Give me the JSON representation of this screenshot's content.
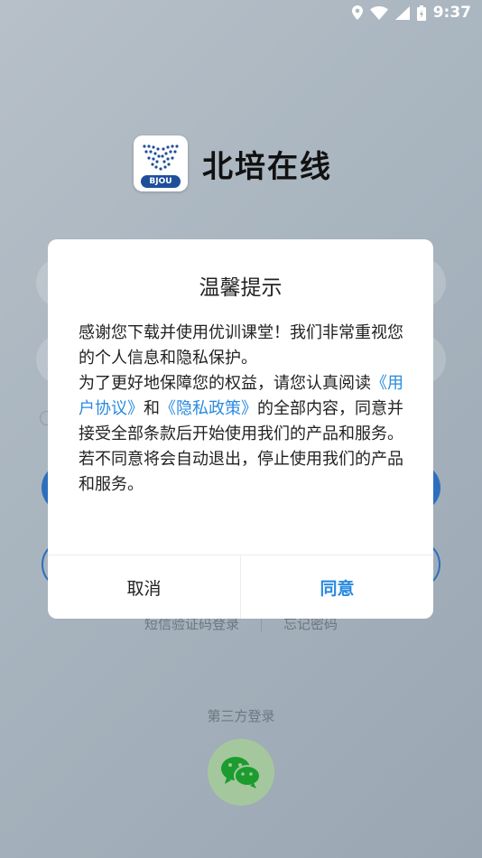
{
  "status_bar": {
    "time": "9:37"
  },
  "app": {
    "name": "北培在线",
    "logo_text": "BJOU"
  },
  "background": {
    "sms_login": "短信验证码登录",
    "forgot_password": "忘记密码",
    "third_party_login": "第三方登录"
  },
  "dialog": {
    "title": "温馨提示",
    "p1": "感谢您下载并使用优训课堂！我们非常重视您的个人信息和隐私保护。",
    "p2_prefix": "为了更好地保障您的权益，请您认真阅读",
    "user_agreement": "《用户协议》",
    "and": "和",
    "privacy_policy": "《隐私政策》",
    "p2_suffix": "的全部内容，同意并接受全部条款后开始使用我们的产品和服务。",
    "p3": "若不同意将会自动退出，停止使用我们的产品和服务。",
    "cancel": "取消",
    "agree": "同意"
  },
  "colors": {
    "accent": "#2a8ae0",
    "brand_blue": "#1f4f9a",
    "wechat_green": "#1aad19"
  }
}
